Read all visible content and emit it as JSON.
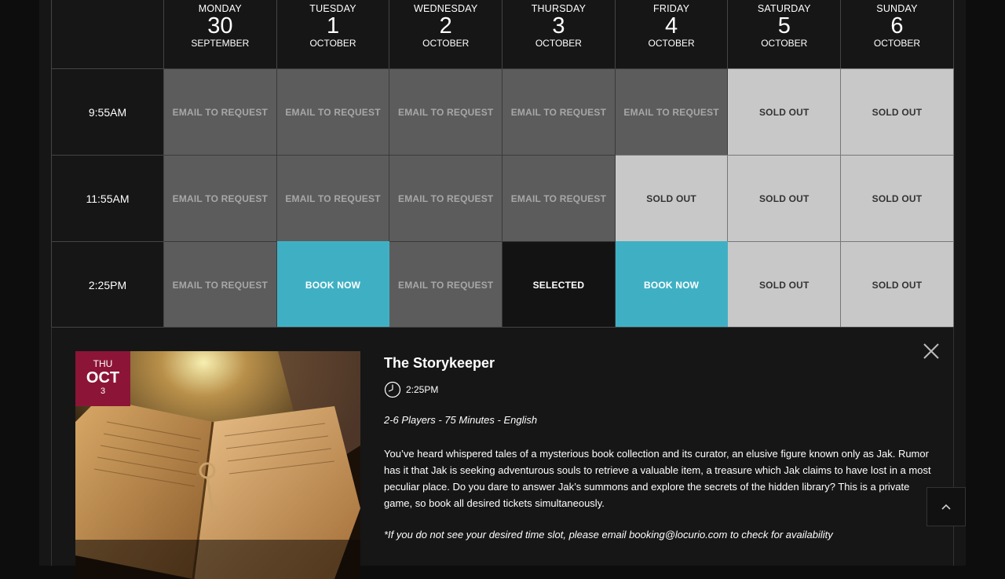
{
  "days": [
    {
      "name": "MONDAY",
      "num": "30",
      "month": "SEPTEMBER"
    },
    {
      "name": "TUESDAY",
      "num": "1",
      "month": "OCTOBER"
    },
    {
      "name": "WEDNESDAY",
      "num": "2",
      "month": "OCTOBER"
    },
    {
      "name": "THURSDAY",
      "num": "3",
      "month": "OCTOBER"
    },
    {
      "name": "FRIDAY",
      "num": "4",
      "month": "OCTOBER"
    },
    {
      "name": "SATURDAY",
      "num": "5",
      "month": "OCTOBER"
    },
    {
      "name": "SUNDAY",
      "num": "6",
      "month": "OCTOBER"
    }
  ],
  "rows": [
    {
      "time": "9:55AM",
      "slots": [
        {
          "label": "EMAIL TO REQUEST",
          "state": "email"
        },
        {
          "label": "EMAIL TO REQUEST",
          "state": "email"
        },
        {
          "label": "EMAIL TO REQUEST",
          "state": "email"
        },
        {
          "label": "EMAIL TO REQUEST",
          "state": "email"
        },
        {
          "label": "EMAIL TO REQUEST",
          "state": "email"
        },
        {
          "label": "SOLD OUT",
          "state": "sold"
        },
        {
          "label": "SOLD OUT",
          "state": "sold"
        }
      ]
    },
    {
      "time": "11:55AM",
      "slots": [
        {
          "label": "EMAIL TO REQUEST",
          "state": "email"
        },
        {
          "label": "EMAIL TO REQUEST",
          "state": "email"
        },
        {
          "label": "EMAIL TO REQUEST",
          "state": "email"
        },
        {
          "label": "EMAIL TO REQUEST",
          "state": "email"
        },
        {
          "label": "SOLD OUT",
          "state": "sold"
        },
        {
          "label": "SOLD OUT",
          "state": "sold"
        },
        {
          "label": "SOLD OUT",
          "state": "sold"
        }
      ]
    },
    {
      "time": "2:25PM",
      "slots": [
        {
          "label": "EMAIL TO REQUEST",
          "state": "email"
        },
        {
          "label": "BOOK NOW",
          "state": "book"
        },
        {
          "label": "EMAIL TO REQUEST",
          "state": "email"
        },
        {
          "label": "SELECTED",
          "state": "selected"
        },
        {
          "label": "BOOK NOW",
          "state": "book"
        },
        {
          "label": "SOLD OUT",
          "state": "sold"
        },
        {
          "label": "SOLD OUT",
          "state": "sold"
        }
      ]
    }
  ],
  "detail": {
    "badge_day": "THU",
    "badge_month": "OCT",
    "badge_num": "3",
    "title": "The Storykeeper",
    "time": "2:25PM",
    "meta": "2-6 Players - 75 Minutes - English",
    "description": "You’ve heard whispered tales of a mysterious book collection and its curator, an elusive figure known only as Jak. Rumor has it that Jak is seeking adventurous souls to retrieve a valuable item, a treasure which Jak claims to have lost in a most peculiar place. Do you dare to answer Jak’s summons and explore the secrets of the hidden library? This is a private game, so book all desired tickets simultaneously.",
    "note": "*If you do not see your desired time slot, please email booking@locurio.com to check for availability"
  },
  "colors": {
    "book": "#3fb0c4",
    "email": "#5c5c5c",
    "sold": "#c8c8c8",
    "badge": "#8c1537"
  },
  "icons": {
    "close": "close-icon",
    "clock": "clock-icon",
    "scroll_top": "chevron-up-icon"
  }
}
